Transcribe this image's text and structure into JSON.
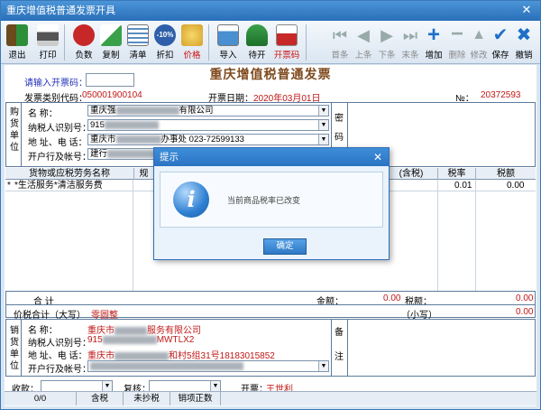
{
  "window": {
    "title": "重庆增值税普通发票开具"
  },
  "toolbar": {
    "exit": "退出",
    "print": "打印",
    "negative": "负数",
    "copy": "复制",
    "list": "清单",
    "discount": "折扣",
    "discount_badge": "-10%",
    "price": "价格",
    "import": "导入",
    "pending": "待开",
    "invoice_code": "开票码",
    "first": "首条",
    "prev": "上条",
    "next": "下条",
    "last": "末条",
    "add": "增加",
    "delete": "删除",
    "modify": "修改",
    "save": "保存",
    "revoke": "撤销"
  },
  "header": {
    "title": "重庆增值税普通发票",
    "code_prompt": "请输入开票码：",
    "code_value": "",
    "category_label": "发票类别代码：",
    "category_value": "050001900104",
    "date_label": "开票日期：",
    "date_value": "2020年03月01日",
    "no_label": "№：",
    "no_value": "20372593"
  },
  "buyer": {
    "side_label": [
      "购",
      "货",
      "单",
      "位"
    ],
    "name_label": "名       称：",
    "name_value_prefix": "重庆强",
    "name_value_suffix": "有限公司",
    "tax_label": "纳税人识别号：",
    "tax_value": "915",
    "addr_label": "地  址、电  话：",
    "addr_value_prefix": "重庆市",
    "addr_value_mid": "办事处",
    "addr_value_phone": "023-72599133",
    "bank_label": "开户行及帐号：",
    "bank_value": "建行",
    "cipher_label": [
      "密",
      "码"
    ]
  },
  "table": {
    "headers": [
      "货物或应税劳务名称",
      "规",
      "(含税)",
      "税率",
      "税额"
    ],
    "rows": [
      {
        "marker": "*",
        "name": "*生活服务*清洁服务费",
        "rate": "0.01",
        "tax": "0.00"
      }
    ]
  },
  "modal": {
    "title": "提示",
    "message": "当前商品税率已改变",
    "ok_label": "确定",
    "icon_glyph": "i"
  },
  "totals": {
    "sum_label": "合          计",
    "amount_label": "金额：",
    "amount_value": "0.00",
    "tax_label": "税额：",
    "tax_value": "0.00",
    "price_tax_label": "价税合计（大写）",
    "price_tax_caps": "零圆整",
    "small_label": "（小写）",
    "small_value": "0.00"
  },
  "seller": {
    "side_label": [
      "销",
      "货",
      "单",
      "位"
    ],
    "name_label": "名       称：",
    "name_value_prefix": "重庆市",
    "name_value_suffix": "服务有限公司",
    "tax_label": "纳税人识别号：",
    "tax_value_prefix": "915",
    "tax_value_suffix": "MWTLX2",
    "addr_label": "地  址、电  话：",
    "addr_value_prefix": "重庆市",
    "addr_value_suffix": "和村5组31号18183015852",
    "bank_label": "开户行及帐号：",
    "remarks_label": [
      "备",
      "注"
    ]
  },
  "footer": {
    "receiver_label": "收款：",
    "reviewer_label": "复核：",
    "drawer_label": "开票：",
    "drawer_value": "王世利"
  },
  "status": {
    "count": "0/0",
    "tax_incl": "含税",
    "unreported": "未抄税",
    "sales_positive": "销项正数"
  }
}
